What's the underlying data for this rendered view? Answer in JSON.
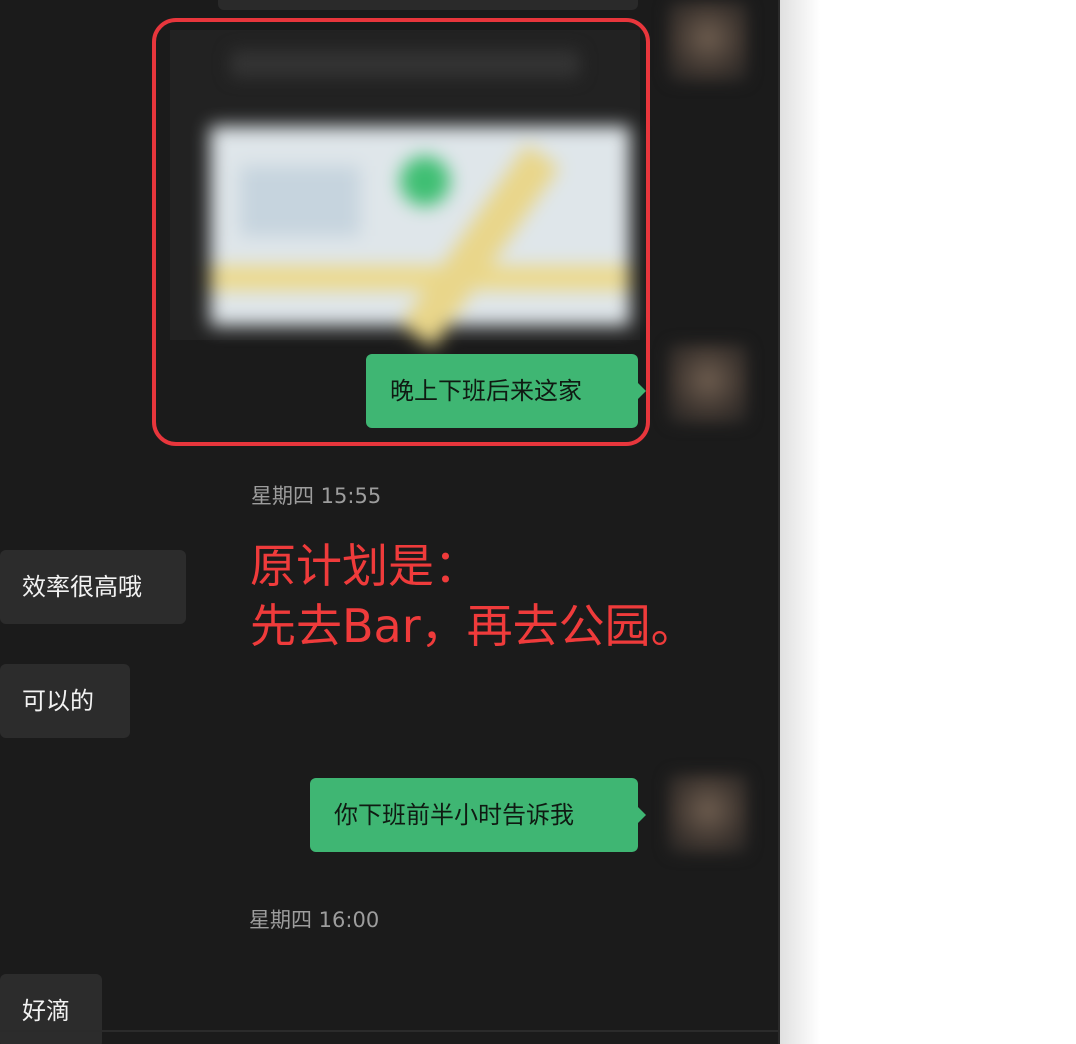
{
  "messages": {
    "image_caption": "晚上下班后来这家",
    "msg_efficient": "效率很高哦",
    "msg_ok": "可以的",
    "msg_tell_me": "你下班前半小时告诉我",
    "msg_good": "好滴"
  },
  "timestamps": {
    "t1": "星期四 15:55",
    "t2": "星期四 16:00"
  },
  "annotation": {
    "line1": "原计划是：",
    "line2": "先去Bar，再去公园。"
  },
  "colors": {
    "sent_bubble": "#3fb673",
    "received_bubble": "#2c2c2c",
    "highlight": "#e8363c",
    "annotation_text": "#ef3b3b"
  }
}
